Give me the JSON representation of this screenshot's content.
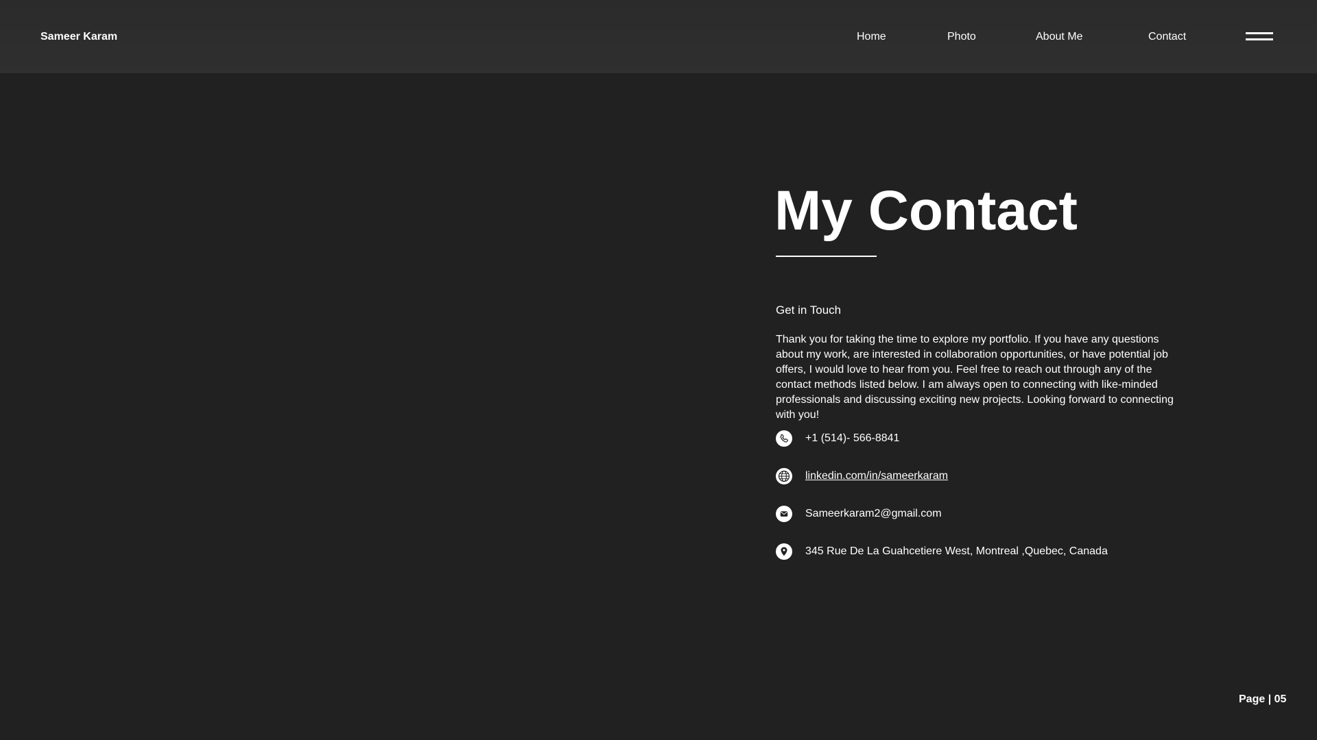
{
  "header": {
    "brand": "Sameer Karam",
    "nav": [
      "Home",
      "Photo",
      "About Me",
      "Contact"
    ],
    "menu_icon": "hamburger-menu-icon"
  },
  "main": {
    "title": "My Contact",
    "subtitle": "Get in Touch",
    "paragraph": "Thank you for taking the time to explore my portfolio. If you have any questions about my work, are interested in collaboration opportunities, or have potential job offers, I would love to hear from you. Feel free to reach out through any of the contact methods listed below. I am always open to connecting with like-minded professionals and discussing exciting new projects. Looking forward to connecting with you!",
    "contacts": [
      {
        "icon": "phone-icon",
        "text": "+1 (514)- 566-8841"
      },
      {
        "icon": "globe-icon",
        "text": "linkedin.com/in/sameerkaram"
      },
      {
        "icon": "email-icon",
        "text": "Sameerkaram2@gmail.com"
      },
      {
        "icon": "location-pin-icon",
        "text": "345 Rue De La Guahcetiere West, Montreal ,Quebec, Canada"
      }
    ]
  },
  "footer": {
    "page_label": "Page | 05"
  },
  "colors": {
    "background": "#202120",
    "header": "#2e2e2e",
    "text": "#ffffff"
  }
}
